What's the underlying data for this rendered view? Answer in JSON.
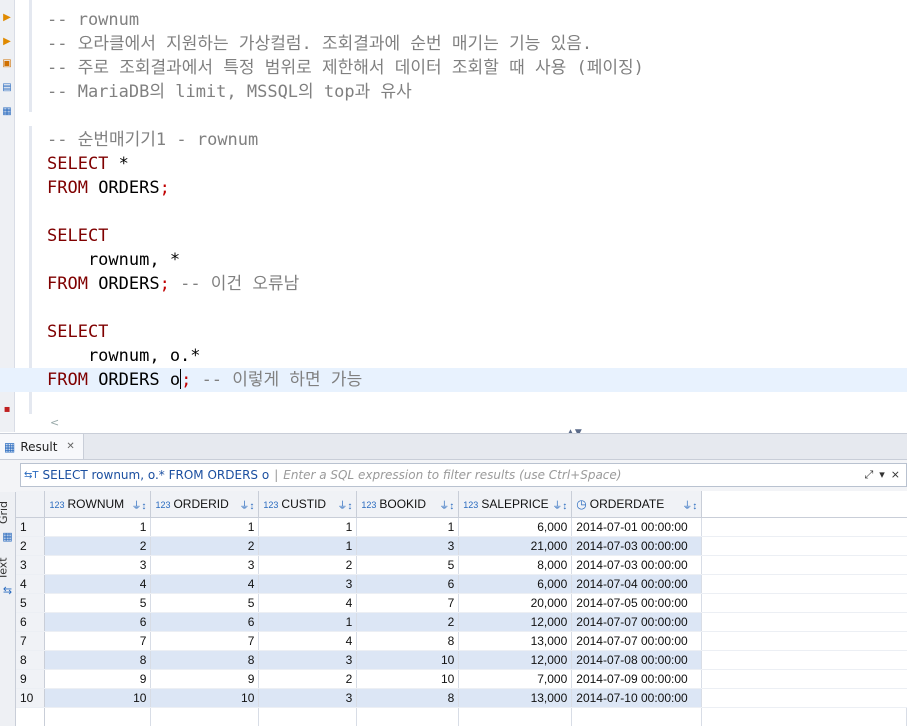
{
  "editor": {
    "lines": [
      [
        {
          "t": "-- rownum",
          "c": "cm"
        }
      ],
      [
        {
          "t": "-- 오라클에서 지원하는 가상컬럼. 조회결과에 순번 매기는 기능 있음.",
          "c": "cm"
        }
      ],
      [
        {
          "t": "-- 주로 조회결과에서 특정 범위로 제한해서 데이터 조회할 때 사용 (페이징)",
          "c": "cm"
        }
      ],
      [
        {
          "t": "-- MariaDB의 limit, MSSQL의 top과 유사",
          "c": "cm"
        }
      ],
      [],
      [
        {
          "t": "-- 순번매기기1 - rownum",
          "c": "cm"
        }
      ],
      [
        {
          "t": "SELECT",
          "c": "kw"
        },
        {
          "t": " *",
          "c": "pl"
        }
      ],
      [
        {
          "t": "FROM",
          "c": "kw"
        },
        {
          "t": " ORDERS",
          "c": "pl"
        },
        {
          "t": ";",
          "c": "sc"
        }
      ],
      [],
      [
        {
          "t": "SELECT",
          "c": "kw"
        }
      ],
      [
        {
          "t": "    rownum, *",
          "c": "pl"
        }
      ],
      [
        {
          "t": "FROM",
          "c": "kw"
        },
        {
          "t": " ORDERS",
          "c": "pl"
        },
        {
          "t": ";",
          "c": "sc"
        },
        {
          "t": " -- 이건 오류남",
          "c": "cm"
        }
      ],
      [],
      [
        {
          "t": "SELECT",
          "c": "kw"
        }
      ],
      [
        {
          "t": "    rownum, o.*",
          "c": "pl"
        }
      ],
      [
        {
          "t": "FROM",
          "c": "kw"
        },
        {
          "t": " ORDERS o",
          "c": "pl"
        },
        {
          "t": "|",
          "c": "caret"
        },
        {
          "t": ";",
          "c": "sc"
        },
        {
          "t": " -- 이렇게 하면 가능",
          "c": "cm"
        }
      ]
    ],
    "current_line": 15
  },
  "result": {
    "tab_label": "Result",
    "filter_query": "SELECT rownum, o.* FROM ORDERS o",
    "filter_placeholder": "Enter a SQL expression to filter results (use Ctrl+Space)",
    "vtab_grid": "Grid",
    "vtab_text": "Text",
    "columns": [
      {
        "type": "123",
        "name": "ROWNUM"
      },
      {
        "type": "123",
        "name": "ORDERID"
      },
      {
        "type": "123",
        "name": "CUSTID"
      },
      {
        "type": "123",
        "name": "BOOKID"
      },
      {
        "type": "123",
        "name": "SALEPRICE"
      },
      {
        "type": "clock",
        "name": "ORDERDATE"
      }
    ],
    "rows": [
      [
        "1",
        "1",
        "1",
        "1",
        "1",
        "6,000",
        "2014-07-01 00:00:00"
      ],
      [
        "2",
        "2",
        "2",
        "1",
        "3",
        "21,000",
        "2014-07-03 00:00:00"
      ],
      [
        "3",
        "3",
        "3",
        "2",
        "5",
        "8,000",
        "2014-07-03 00:00:00"
      ],
      [
        "4",
        "4",
        "4",
        "3",
        "6",
        "6,000",
        "2014-07-04 00:00:00"
      ],
      [
        "5",
        "5",
        "5",
        "4",
        "7",
        "20,000",
        "2014-07-05 00:00:00"
      ],
      [
        "6",
        "6",
        "6",
        "1",
        "2",
        "12,000",
        "2014-07-07 00:00:00"
      ],
      [
        "7",
        "7",
        "7",
        "4",
        "8",
        "13,000",
        "2014-07-07 00:00:00"
      ],
      [
        "8",
        "8",
        "8",
        "3",
        "10",
        "12,000",
        "2014-07-08 00:00:00"
      ],
      [
        "9",
        "9",
        "9",
        "2",
        "10",
        "7,000",
        "2014-07-09 00:00:00"
      ],
      [
        "10",
        "10",
        "10",
        "3",
        "8",
        "13,000",
        "2014-07-10 00:00:00"
      ]
    ]
  },
  "colors": {
    "keyword": "#7f0000",
    "comment": "#808080",
    "current_line": "#e8f2fe",
    "alt_row": "#dce6f5",
    "icon_blue": "#2a6bbf"
  }
}
